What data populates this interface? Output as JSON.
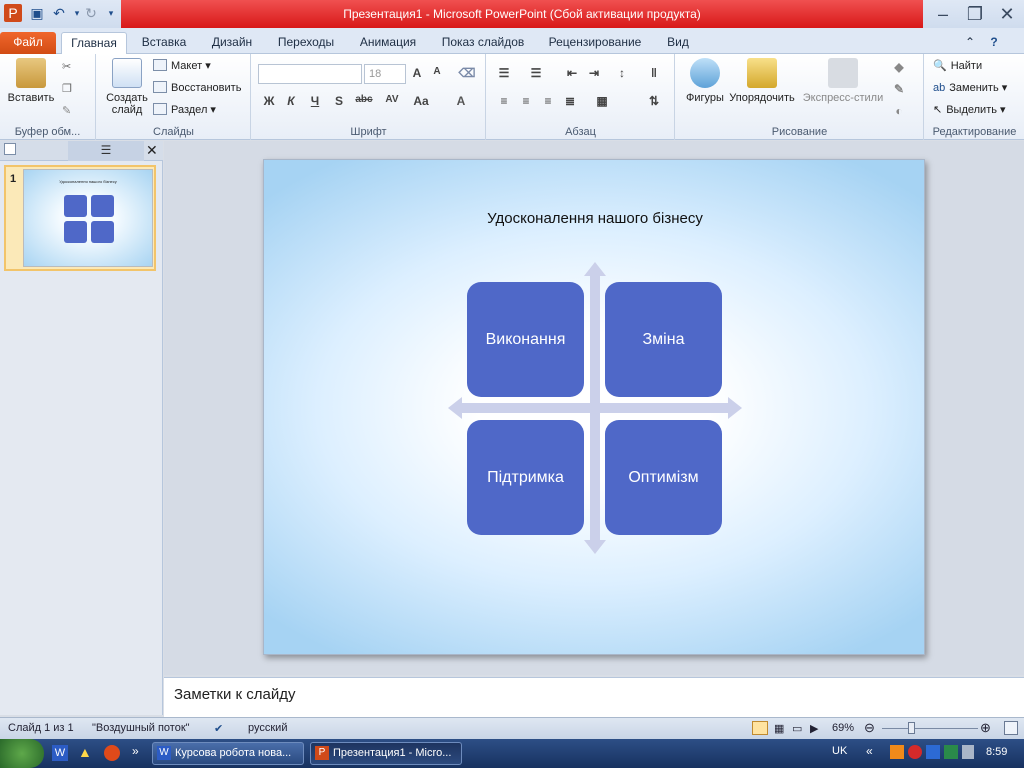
{
  "window": {
    "title": "Презентация1  -  Microsoft PowerPoint (Сбой активации продукта)"
  },
  "tabs": [
    "Файл",
    "Главная",
    "Вставка",
    "Дизайн",
    "Переходы",
    "Анимация",
    "Показ слайдов",
    "Рецензирование",
    "Вид"
  ],
  "ribbon": {
    "clipboard": {
      "paste": "Вставить",
      "label": "Буфер обм..."
    },
    "slides": {
      "new_slide": "Создать слайд",
      "layout": "Макет",
      "reset": "Восстановить",
      "section": "Раздел",
      "label": "Слайды"
    },
    "font": {
      "size": "18",
      "label": "Шрифт"
    },
    "paragraph": {
      "label": "Абзац"
    },
    "drawing": {
      "shapes": "Фигуры",
      "arrange": "Упорядочить",
      "quick_styles": "Экспресс-стили",
      "label": "Рисование"
    },
    "editing": {
      "find": "Найти",
      "replace": "Заменить",
      "select": "Выделить",
      "label": "Редактирование"
    }
  },
  "thumbnails": [
    {
      "number": "1"
    }
  ],
  "slide": {
    "title": "Удосконалення нашого бізнесу",
    "boxes": [
      "Виконання",
      "Зміна",
      "Підтримка",
      "Оптимізм"
    ]
  },
  "notes": {
    "placeholder": "Заметки к слайду"
  },
  "status": {
    "slide_info": "Слайд 1 из 1",
    "theme": "\"Воздушный поток\"",
    "language": "русский",
    "zoom": "69%"
  },
  "taskbar": {
    "items": [
      "Курсова робота нова...",
      "Презентация1 - Micro..."
    ],
    "lang": "UK",
    "time": "8:59"
  }
}
